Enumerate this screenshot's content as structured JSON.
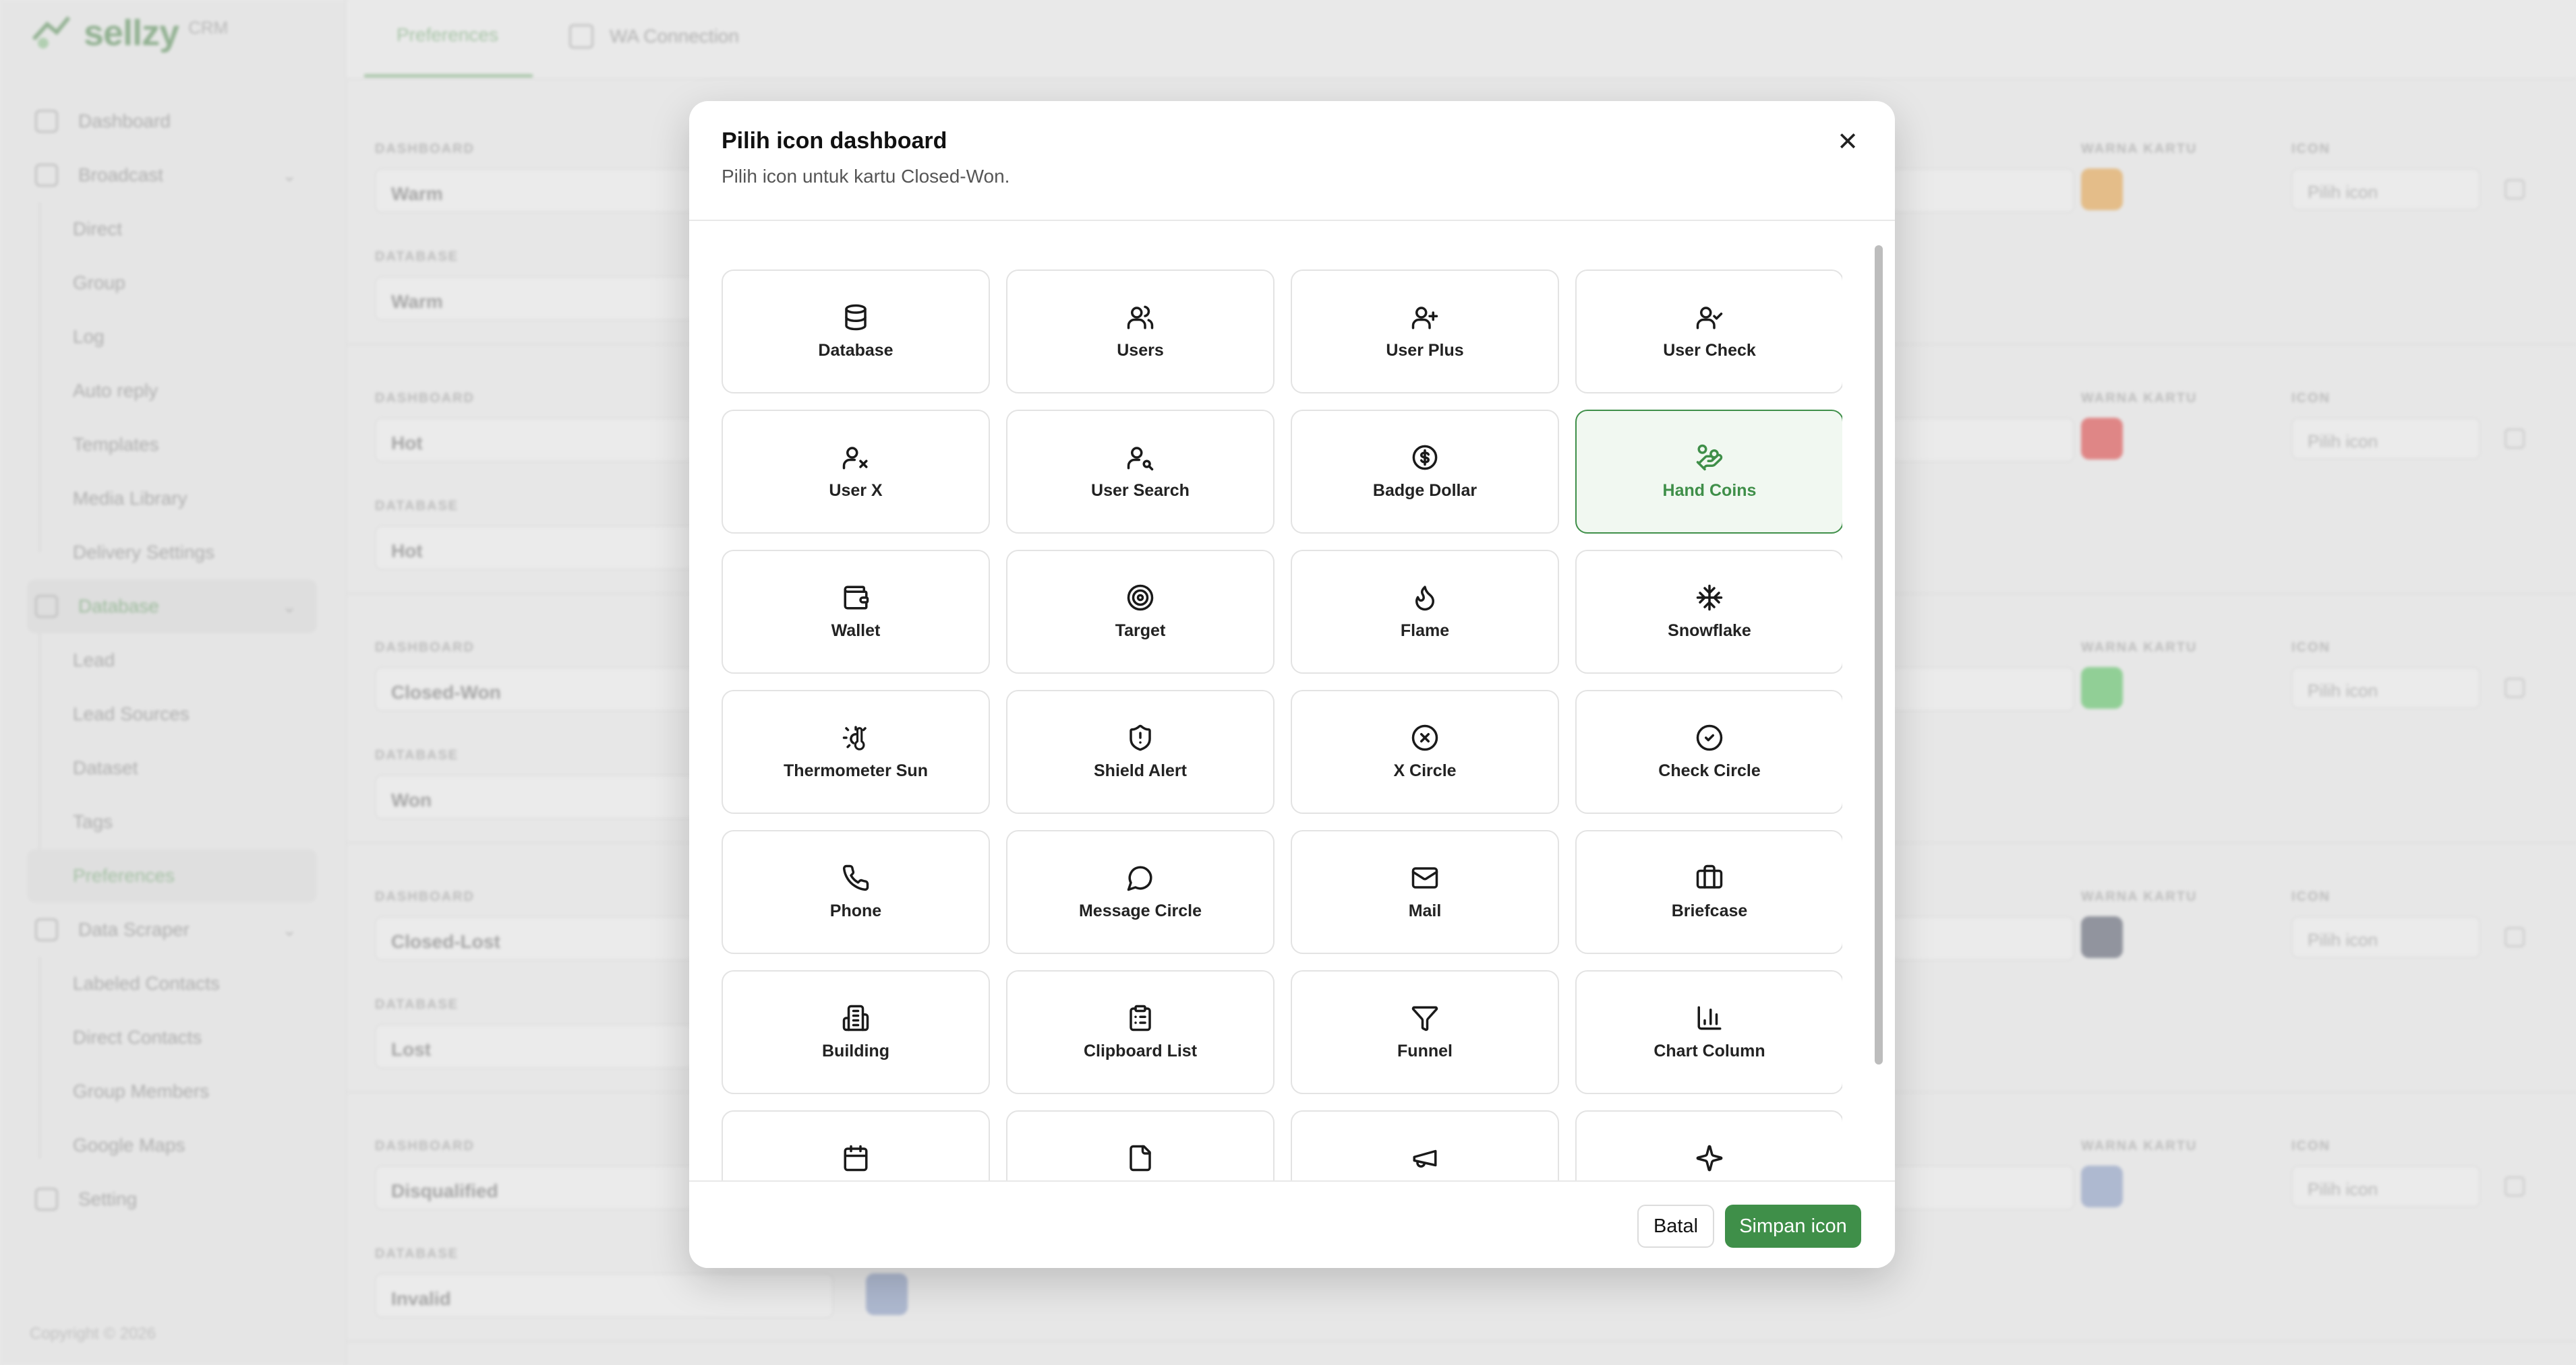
{
  "app": {
    "logo_text": "sellzy",
    "logo_tag": "CRM",
    "copyright": "Copyright © 2026"
  },
  "sidebar": {
    "items": [
      {
        "label": "Dashboard",
        "kind": "top"
      },
      {
        "label": "Broadcast",
        "kind": "top",
        "chevron": "⌄"
      },
      {
        "label": "Direct",
        "kind": "sub"
      },
      {
        "label": "Group",
        "kind": "sub"
      },
      {
        "label": "Log",
        "kind": "sub"
      },
      {
        "label": "Auto reply",
        "kind": "sub"
      },
      {
        "label": "Templates",
        "kind": "sub"
      },
      {
        "label": "Media Library",
        "kind": "sub"
      },
      {
        "label": "Delivery Settings",
        "kind": "sub"
      },
      {
        "label": "Database",
        "kind": "top",
        "chevron": "⌄",
        "active": true
      },
      {
        "label": "Lead",
        "kind": "sub"
      },
      {
        "label": "Lead Sources",
        "kind": "sub"
      },
      {
        "label": "Dataset",
        "kind": "sub"
      },
      {
        "label": "Tags",
        "kind": "sub"
      },
      {
        "label": "Preferences",
        "kind": "sub",
        "current": true
      },
      {
        "label": "Data Scraper",
        "kind": "top",
        "chevron": "⌄"
      },
      {
        "label": "Labeled Contacts",
        "kind": "sub"
      },
      {
        "label": "Direct Contacts",
        "kind": "sub"
      },
      {
        "label": "Group Members",
        "kind": "sub"
      },
      {
        "label": "Google Maps",
        "kind": "sub"
      },
      {
        "label": "Setting",
        "kind": "top"
      }
    ]
  },
  "tabs": {
    "preferences": "Preferences",
    "wa_connection": "WA Connection"
  },
  "background_rows": {
    "label_dashboard": "DASHBOARD",
    "label_database": "DATABASE",
    "label_color": "WARNA KARTU",
    "label_icon": "ICON",
    "icon_placeholder": "Pilih icon",
    "rows": [
      {
        "dashboard": "Warm",
        "database": "Warm",
        "color": "#e0a24e"
      },
      {
        "dashboard": "Hot",
        "database": "Hot",
        "color": "#d94a4a"
      },
      {
        "dashboard": "Closed-Won",
        "database": "Won",
        "color": "#5bbf63"
      },
      {
        "dashboard": "Closed-Lost",
        "database": "Lost",
        "color": "#5b6070"
      },
      {
        "dashboard": "Disqualified",
        "database": "Invalid",
        "color": "#8a9bc0"
      }
    ]
  },
  "dialog": {
    "title": "Pilih icon dashboard",
    "subtitle": "Pilih icon untuk kartu Closed-Won.",
    "close_glyph": "✕",
    "cancel_label": "Batal",
    "save_label": "Simpan icon",
    "accent_color": "#3f8f49",
    "selected_icon": "Hand Coins",
    "icons": [
      {
        "label": "Database",
        "icon": "database-icon"
      },
      {
        "label": "Users",
        "icon": "users-icon"
      },
      {
        "label": "User Plus",
        "icon": "user-plus-icon"
      },
      {
        "label": "User Check",
        "icon": "user-check-icon"
      },
      {
        "label": "User X",
        "icon": "user-x-icon"
      },
      {
        "label": "User Search",
        "icon": "user-search-icon"
      },
      {
        "label": "Badge Dollar",
        "icon": "badge-dollar-icon"
      },
      {
        "label": "Hand Coins",
        "icon": "hand-coins-icon"
      },
      {
        "label": "Wallet",
        "icon": "wallet-icon"
      },
      {
        "label": "Target",
        "icon": "target-icon"
      },
      {
        "label": "Flame",
        "icon": "flame-icon"
      },
      {
        "label": "Snowflake",
        "icon": "snowflake-icon"
      },
      {
        "label": "Thermometer Sun",
        "icon": "thermometer-sun-icon"
      },
      {
        "label": "Shield Alert",
        "icon": "shield-alert-icon"
      },
      {
        "label": "X Circle",
        "icon": "x-circle-icon"
      },
      {
        "label": "Check Circle",
        "icon": "check-circle-icon"
      },
      {
        "label": "Phone",
        "icon": "phone-icon"
      },
      {
        "label": "Message Circle",
        "icon": "message-circle-icon"
      },
      {
        "label": "Mail",
        "icon": "mail-icon"
      },
      {
        "label": "Briefcase",
        "icon": "briefcase-icon"
      },
      {
        "label": "Building",
        "icon": "building-icon"
      },
      {
        "label": "Clipboard List",
        "icon": "clipboard-list-icon"
      },
      {
        "label": "Funnel",
        "icon": "funnel-icon"
      },
      {
        "label": "Chart Column",
        "icon": "chart-column-icon"
      },
      {
        "label": "",
        "icon": "calendar-icon"
      },
      {
        "label": "",
        "icon": "file-icon"
      },
      {
        "label": "",
        "icon": "megaphone-icon"
      },
      {
        "label": "",
        "icon": "sparkles-icon"
      }
    ]
  }
}
